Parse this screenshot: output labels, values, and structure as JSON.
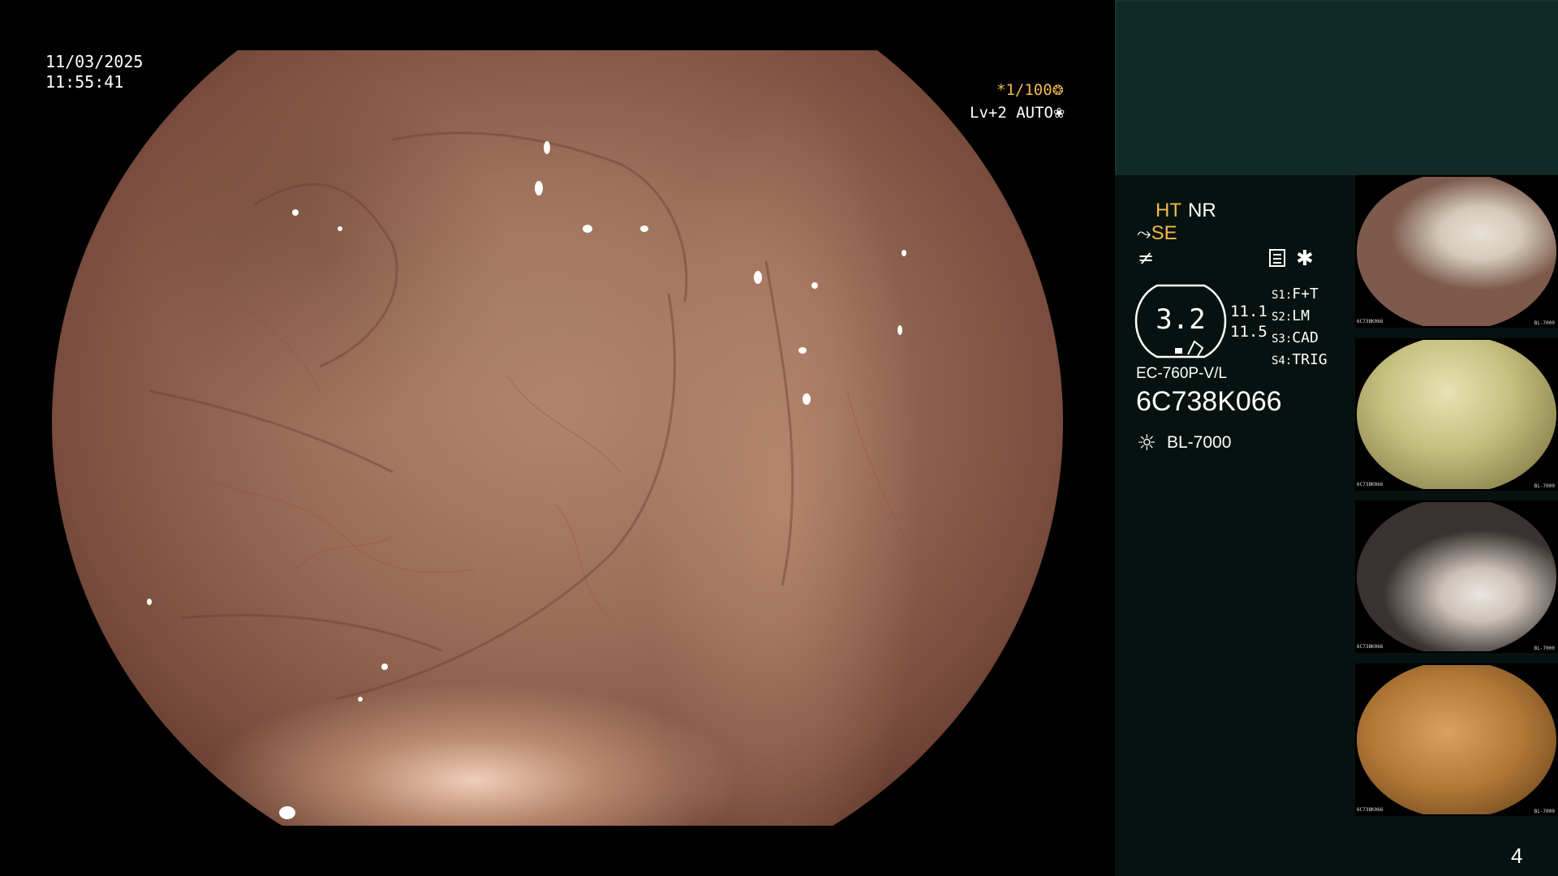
{
  "overlay": {
    "date": "11/03/2025",
    "time": "11:55:41",
    "shutter": "*1/100",
    "shutter_icon": "❂",
    "agc": "Lv+2 AUTO",
    "agc_icon": "❀"
  },
  "panel": {
    "ht_label": "HT",
    "nr_label": "NR",
    "se_symbol": "⤳",
    "se_label": "SE",
    "ne_icon": "≠",
    "star_icon": "✱",
    "zoom": "3.2",
    "values": [
      "11.1",
      "11.5"
    ],
    "switches": [
      {
        "key": "S1:",
        "value": "F+T"
      },
      {
        "key": "S2:",
        "value": "LM"
      },
      {
        "key": "S3:",
        "value": "CAD"
      },
      {
        "key": "S4:",
        "value": "TRIG"
      }
    ],
    "scope_model": "EC-760P-V/L",
    "scope_serial": "6C738K066",
    "light_icon": "☼",
    "light_source": "BL-7000",
    "image_count": "4"
  },
  "thumbnails": [
    {
      "id": "4",
      "serial": "6C738K066",
      "light": "BL-7000"
    },
    {
      "id": "3",
      "serial": "6C738K066",
      "light": "BL-7000"
    },
    {
      "id": "2",
      "serial": "6C738K066",
      "light": "BL-7000"
    },
    {
      "id": "1",
      "serial": "6C738K066",
      "light": "BL-7000"
    }
  ],
  "colors": {
    "panel_bg": "#071210",
    "panel_top_bg": "#102a28",
    "accent_yellow": "#f0b84c"
  }
}
